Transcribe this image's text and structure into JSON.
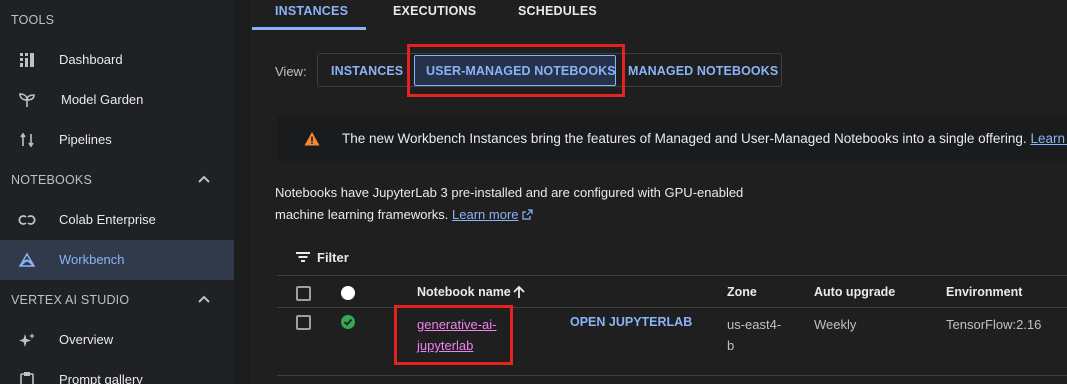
{
  "sidebar": {
    "sections": {
      "tools": "TOOLS",
      "notebooks": "NOTEBOOKS",
      "vertex_ai_studio": "VERTEX AI STUDIO"
    },
    "items": {
      "dashboard": "Dashboard",
      "model_garden": "Model Garden",
      "pipelines": "Pipelines",
      "colab_enterprise": "Colab Enterprise",
      "workbench": "Workbench",
      "overview": "Overview",
      "prompt_gallery": "Prompt gallery"
    }
  },
  "tabs": {
    "instances": "INSTANCES",
    "executions": "EXECUTIONS",
    "schedules": "SCHEDULES"
  },
  "view": {
    "label": "View:",
    "instances": "INSTANCES",
    "user_managed": "USER-MANAGED NOTEBOOKS",
    "managed": "MANAGED NOTEBOOKS"
  },
  "banner": {
    "text": "The new Workbench Instances bring the features of Managed and User-Managed Notebooks into a single offering.",
    "link": "Learn more"
  },
  "description": {
    "line1": "Notebooks have JupyterLab 3 pre-installed and are configured with GPU-enabled",
    "line2": "machine learning frameworks.",
    "link": "Learn more"
  },
  "filter": {
    "label": "Filter"
  },
  "table": {
    "headers": {
      "name": "Notebook name",
      "zone": "Zone",
      "auto_upgrade": "Auto upgrade",
      "environment": "Environment"
    },
    "rows": [
      {
        "name_line1": "generative-ai-",
        "name_line2": "jupyterlab",
        "action": "OPEN JUPYTERLAB",
        "zone_line1": "us-east4-",
        "zone_line2": "b",
        "auto_upgrade": "Weekly",
        "environment": "TensorFlow:2.16"
      }
    ]
  },
  "colors": {
    "accent": "#8ab4f8",
    "highlight": "#e5231e",
    "status_ok": "#34a853",
    "warning": "#f28b30"
  }
}
